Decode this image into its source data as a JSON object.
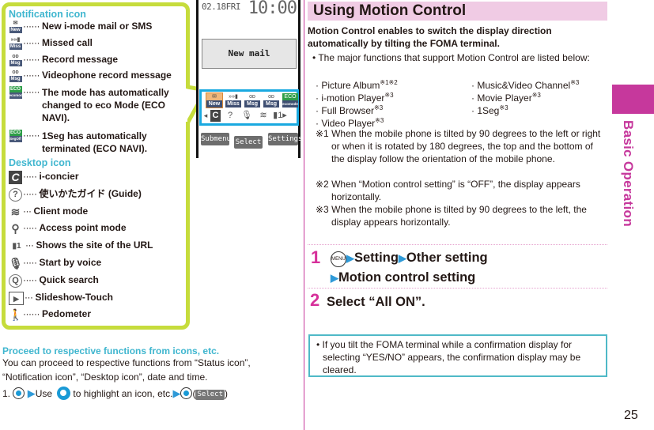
{
  "callout": {
    "notification_heading": "Notification icon",
    "notification_items": [
      {
        "icon": "new-mail-icon",
        "top": "",
        "bot": "New",
        "text": "New i-mode mail or SMS"
      },
      {
        "icon": "missed-call-icon",
        "top": "»»▮",
        "bot": "Miss",
        "text": "Missed call"
      },
      {
        "icon": "record-message-icon",
        "top": "ᴏᴅ",
        "bot": "Msg",
        "text": "Record message"
      },
      {
        "icon": "videophone-record-message-icon",
        "top": "ᴏᴅ",
        "bot": "Msg",
        "text": "Videophone record message"
      },
      {
        "icon": "eco-mode-icon",
        "top": "ECO",
        "bot": "ecomode",
        "text": "The mode has automatically\nchanged to eco Mode (ECO\nNAVI)."
      },
      {
        "icon": "1seg-eco-off-icon",
        "top": "ECO",
        "bot": "SegOff",
        "text": "1Seg has automatically\nterminated (ECO NAVI)."
      }
    ],
    "desktop_heading": "Desktop icon",
    "desktop_items": [
      {
        "icon": "i-concier-icon",
        "glyph": "C",
        "dots": "·····",
        "text": "i-concier"
      },
      {
        "icon": "guide-icon",
        "glyph": "?",
        "dots": "·····",
        "text": "使いかたガイド (Guide)"
      },
      {
        "icon": "client-mode-icon",
        "glyph": "≋",
        "dots": "···",
        "text": "Client mode"
      },
      {
        "icon": "access-point-mode-icon",
        "glyph": "⚲",
        "dots": "·····",
        "text": "Access point mode"
      },
      {
        "icon": "url-site-icon",
        "glyph": "▮1",
        "dots": "···",
        "text": "Shows the site of the URL"
      },
      {
        "icon": "start-by-voice-icon",
        "glyph": "🎙",
        "dots": "·····",
        "text": "Start by voice"
      },
      {
        "icon": "quick-search-icon",
        "glyph": "Q",
        "dots": "·····",
        "text": "Quick search"
      },
      {
        "icon": "slideshow-touch-icon",
        "glyph": "▶",
        "dots": "···",
        "text": "Slideshow-Touch"
      },
      {
        "icon": "pedometer-icon",
        "glyph": "🚶",
        "dots": "······",
        "text": "Pedometer"
      }
    ],
    "dots": "······"
  },
  "phone": {
    "date": "02.18FRI",
    "time": "10:00",
    "new_mail": "New mail",
    "notif_icons": [
      {
        "top": "✉",
        "bot": "New"
      },
      {
        "top": "»»▮",
        "bot": "Miss"
      },
      {
        "top": "ᴏᴅ",
        "bot": "Msg"
      },
      {
        "top": "ᴏᴅ",
        "bot": "Msg"
      },
      {
        "top": "ECO",
        "bot": "ecomode"
      }
    ],
    "desktop_icons": [
      "◂",
      "C",
      "?",
      "🎙",
      "≋",
      "▮1▸"
    ],
    "softkeys": {
      "left": "Submenu",
      "center": "Select",
      "right": "Settings"
    }
  },
  "main": {
    "title": "Using Motion Control",
    "intro": "Motion Control enables to switch the display direction automatically by tilting the FOMA terminal.",
    "bullet": "• The major functions that support Motion Control are listed below:",
    "functions": [
      {
        "name": "· Picture Album",
        "marks": "※1※2"
      },
      {
        "name": "· Music&Video Channel",
        "marks": "※3"
      },
      {
        "name": "· i-motion Player",
        "marks": "※3"
      },
      {
        "name": "· Movie Player",
        "marks": "※3"
      },
      {
        "name": "· Full Browser",
        "marks": "※3"
      },
      {
        "name": "· 1Seg",
        "marks": "※3"
      },
      {
        "name": "· Video Player",
        "marks": "※3"
      }
    ],
    "notes": [
      "※1 When the mobile phone is tilted by 90 degrees to the left or right or when it is rotated by 180 degrees, the top and the bottom of the display follow the orientation of the mobile phone.",
      "※2 When “Motion control setting” is “OFF”, the display appears horizontally.",
      "※3 When the mobile phone is tilted by 90 degrees to the left, the display appears horizontally."
    ],
    "steps": [
      {
        "num": "1",
        "menu_key": "MENU",
        "parts": [
          "Setting",
          "Other setting",
          "Motion control setting"
        ]
      },
      {
        "num": "2",
        "text": "Select “All ON”."
      }
    ],
    "info": "If you tilt the FOMA terminal while a confirmation display for selecting “YES/NO” appears, the confirmation display may be cleared."
  },
  "proceed": {
    "heading": "Proceed to respective functions from icons, etc.",
    "body": "You can proceed to respective functions from “Status icon”, “Notification icon”, “Desktop icon”, date and time.",
    "step_prefix": "1.",
    "step_use": "Use",
    "step_mid": "to highlight an icon, etc.",
    "select_key": "Select"
  },
  "side": {
    "label": "Basic Operation"
  },
  "page_number": "25",
  "colors": {
    "accent_pink": "#c6389c",
    "accent_cyan": "#3fb6cf",
    "callout_green": "#c6dc3c",
    "title_bg": "#f0cbe4",
    "arrow_blue": "#2f9ad8"
  }
}
